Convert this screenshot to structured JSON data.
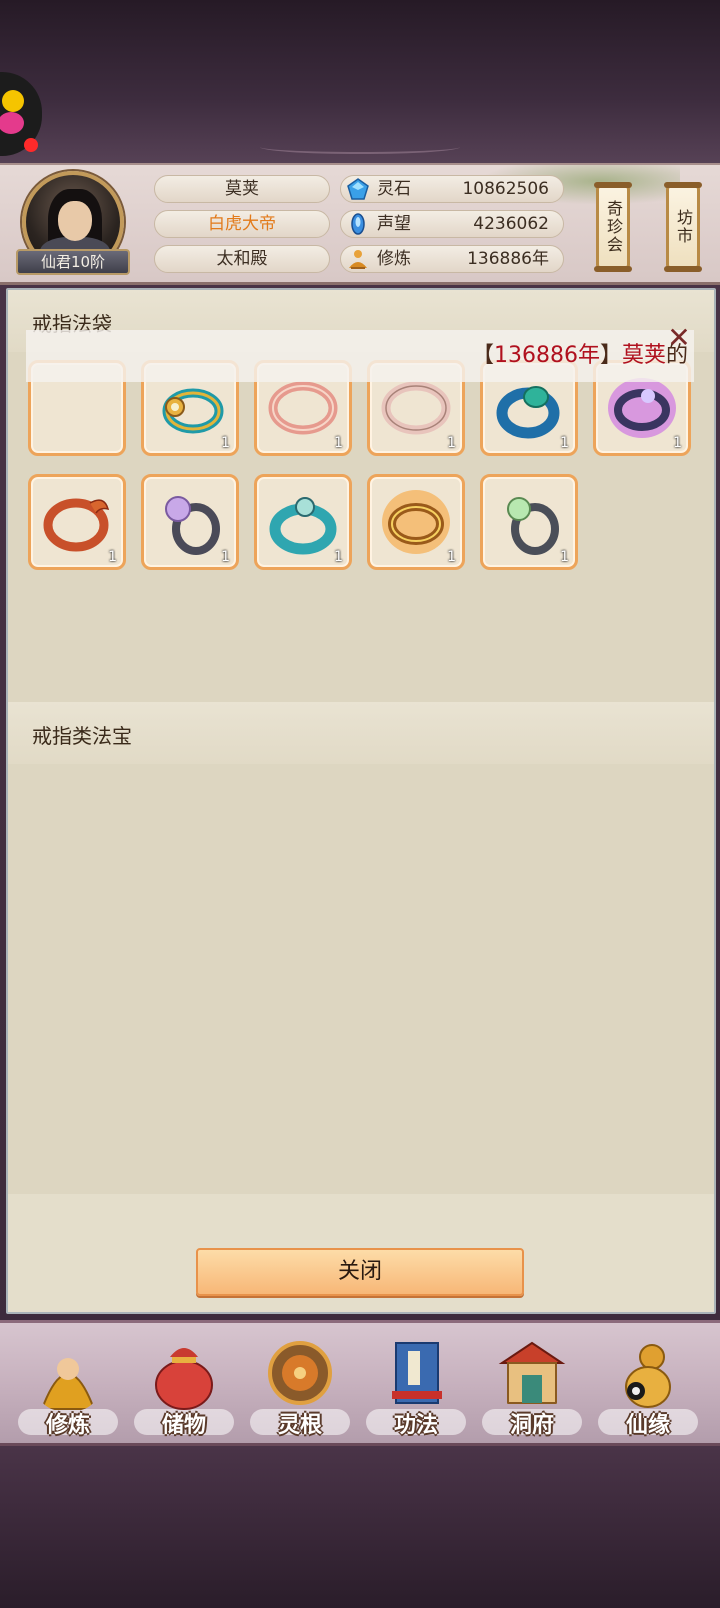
{
  "header": {
    "rank_label": "仙君10阶",
    "name": "莫荚",
    "title": "白虎大帝",
    "hall": "太和殿",
    "resources": [
      {
        "icon": "spirit-stone-icon",
        "label": "灵石",
        "value": "10862506"
      },
      {
        "icon": "prestige-icon",
        "label": "声望",
        "value": "4236062"
      },
      {
        "icon": "cultivation-icon",
        "label": "修炼",
        "value": "136886年"
      }
    ],
    "side_buttons": [
      {
        "label": "奇珍会"
      },
      {
        "label": "坊市"
      }
    ]
  },
  "sections": {
    "ring_bag": {
      "title": "戒指法袋"
    },
    "ring_treasures": {
      "title": "戒指类法宝"
    }
  },
  "notice": {
    "bracket_open": "【",
    "years": "136886年",
    "bracket_close": "】",
    "name": "莫荚",
    "suffix": "的"
  },
  "slots": [
    {
      "icon": "empty-slot",
      "qty": ""
    },
    {
      "icon": "golden-teal-ring-icon",
      "qty": "1"
    },
    {
      "icon": "rose-gold-ring-icon",
      "qty": "1"
    },
    {
      "icon": "pale-pink-ring-icon",
      "qty": "1"
    },
    {
      "icon": "jade-blue-ring-icon",
      "qty": "1"
    },
    {
      "icon": "purple-aura-ring-icon",
      "qty": "1"
    },
    {
      "icon": "red-dragon-ring-icon",
      "qty": "1"
    },
    {
      "icon": "purple-pearl-ring-icon",
      "qty": "1"
    },
    {
      "icon": "teal-band-ring-icon",
      "qty": "1"
    },
    {
      "icon": "golden-flame-ring-icon",
      "qty": "1"
    },
    {
      "icon": "green-pearl-ring-icon",
      "qty": "1"
    }
  ],
  "close_button": {
    "label": "关闭"
  },
  "nav": [
    {
      "icon": "monk-icon",
      "label": "修炼"
    },
    {
      "icon": "treasure-bag-icon",
      "label": "储物"
    },
    {
      "icon": "spirit-root-icon",
      "label": "灵根"
    },
    {
      "icon": "book-icon",
      "label": "功法"
    },
    {
      "icon": "cave-palace-icon",
      "label": "洞府"
    },
    {
      "icon": "gourd-icon",
      "label": "仙缘"
    }
  ],
  "colors": {
    "slot_border": "#eda45a",
    "notice_text": "#b0101e",
    "title_orange": "#e27a1a"
  }
}
